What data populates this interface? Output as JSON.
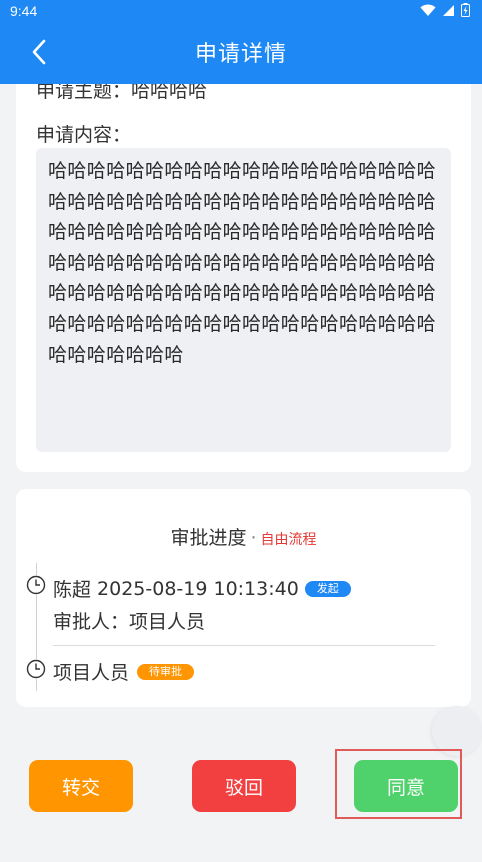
{
  "status_bar": {
    "time": "9:44",
    "icons": [
      "wifi-icon",
      "signal-icon",
      "battery-icon"
    ]
  },
  "header": {
    "title": "申请详情",
    "back_icon": "chevron-left-icon",
    "background_color": "#1e88f5"
  },
  "application": {
    "subject_label": "申请主题：",
    "subject_value": "哈哈哈哈",
    "content_label": "申请内容：",
    "content_value": "哈哈哈哈哈哈哈哈哈哈哈哈哈哈哈哈哈哈哈哈哈哈哈哈哈哈哈哈哈哈哈哈哈哈哈哈哈哈哈哈哈哈哈哈哈哈哈哈哈哈哈哈哈哈哈哈哈哈哈哈哈哈哈哈哈哈哈哈哈哈哈哈哈哈哈哈哈哈哈哈哈哈哈哈哈哈哈哈哈哈哈哈哈哈哈哈哈哈哈哈哈哈哈哈哈哈哈哈哈哈哈哈哈哈哈哈哈哈哈哈哈哈哈哈哈哈哈"
  },
  "progress": {
    "title": "审批进度",
    "separator": "·",
    "flow_type": "自由流程",
    "steps": [
      {
        "name": "陈超",
        "time": "2025-08-19 10:13:40",
        "badge": "发起",
        "approver_label": "审批人：",
        "approver_value": "项目人员"
      },
      {
        "name": "项目人员",
        "badge": "待审批"
      }
    ]
  },
  "actions": {
    "transfer": "转交",
    "reject": "驳回",
    "agree": "同意"
  },
  "colors": {
    "transfer": "#ff9500",
    "reject": "#f24040",
    "agree": "#4fd26b",
    "badge_start": "#1e88f5",
    "badge_pending": "#ff9500",
    "flow_text": "#e53935"
  }
}
